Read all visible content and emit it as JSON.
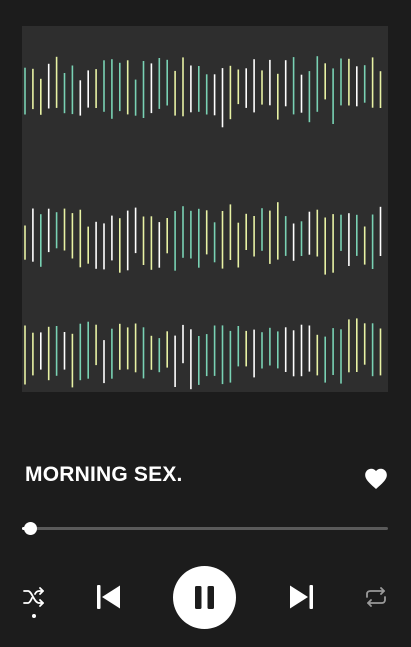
{
  "track": {
    "title": "MORNING SEX.",
    "liked": true,
    "progress_fraction": 0.02
  },
  "controls": {
    "shuffle_active": true,
    "icons": [
      "shuffle-icon",
      "skip-previous-icon",
      "pause-icon",
      "skip-next-icon",
      "repeat-icon",
      "heart-icon"
    ]
  },
  "colors": {
    "background": "#1c1c1c",
    "artwork_background": "#2e2e2e",
    "waveform_teal": "#79d2b4",
    "waveform_yellow": "#e8f2a4",
    "waveform_white": "#ffffff",
    "track": "#5a5a5a",
    "accent": "#ffffff"
  }
}
